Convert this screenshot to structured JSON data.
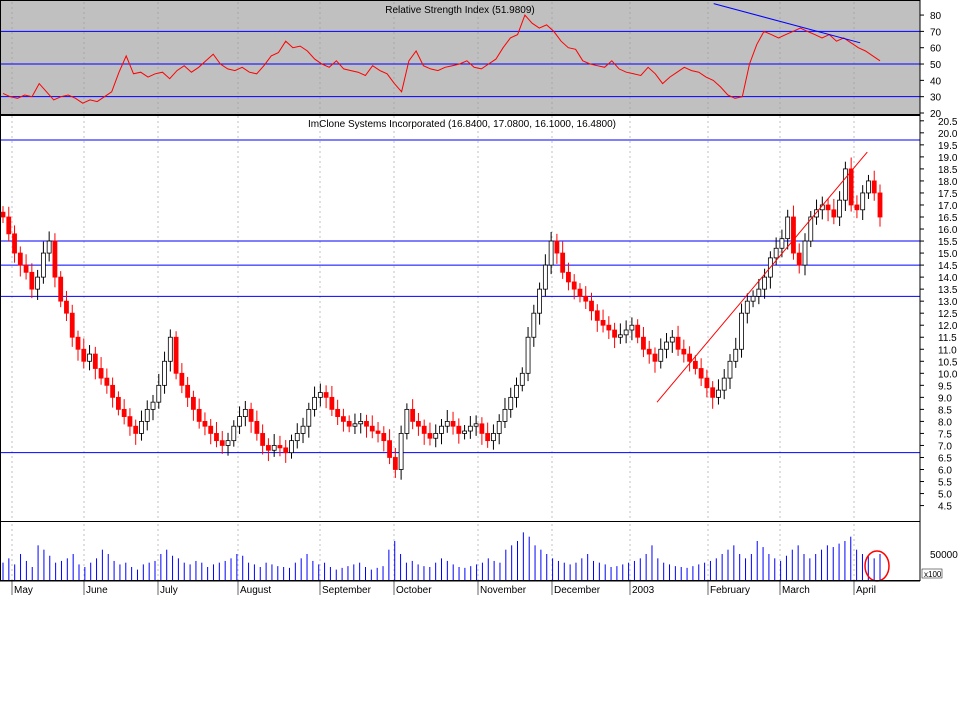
{
  "chart_data": [
    {
      "type": "line",
      "title": "Relative Strength Index (51.9809)",
      "ylim": [
        20,
        88
      ],
      "yticks": [
        20,
        30,
        40,
        50,
        60,
        70,
        80
      ],
      "reference_lines": [
        30,
        50,
        70
      ],
      "trendline": {
        "from": {
          "x": "2003-02-22",
          "y": 87
        },
        "to": {
          "x": "2003-04-25",
          "y": 63
        }
      },
      "background": "#c0c0c0",
      "series": [
        {
          "color": "#ff0000",
          "values": [
            32,
            30,
            29,
            31,
            30,
            38,
            33,
            28,
            30,
            31,
            29,
            26,
            28,
            27,
            30,
            33,
            45,
            55,
            44,
            45,
            42,
            44,
            45,
            41,
            46,
            49,
            45,
            48,
            52,
            56,
            50,
            47,
            46,
            48,
            45,
            44,
            49,
            55,
            57,
            64,
            60,
            61,
            58,
            53,
            50,
            48,
            52,
            47,
            46,
            45,
            43,
            49,
            46,
            44,
            38,
            33,
            52,
            58,
            49,
            47,
            46,
            48,
            49,
            50,
            52,
            48,
            47,
            50,
            53,
            60,
            66,
            68,
            80,
            75,
            72,
            74,
            70,
            64,
            60,
            59,
            52,
            50,
            49,
            48,
            52,
            47,
            45,
            44,
            43,
            48,
            44,
            38,
            42,
            45,
            48,
            46,
            45,
            42,
            40,
            36,
            31,
            29,
            30,
            50,
            62,
            70,
            68,
            66,
            68,
            70,
            72,
            70,
            68,
            66,
            68,
            64,
            66,
            63,
            60,
            58,
            55,
            52
          ]
        }
      ]
    },
    {
      "type": "candlestick",
      "title": "ImClone Systems Incorporated (16.8400, 17.0800, 16.1000, 16.4800)",
      "ylim": [
        3.9,
        20.7
      ],
      "yticks": [
        "4.5",
        "5.0",
        "5.5",
        "6.0",
        "6.5",
        "7.0",
        "7.5",
        "8.0",
        "8.5",
        "9.0",
        "9.5",
        "10.0",
        "10.5",
        "11.0",
        "11.5",
        "12.0",
        "12.5",
        "13.0",
        "13.5",
        "14.0",
        "14.5",
        "15.0",
        "15.5",
        "16.0",
        "16.5",
        "17.0",
        "17.5",
        "18.0",
        "18.5",
        "19.0",
        "19.5",
        "20.0",
        "20.5"
      ],
      "horizontal_lines": [
        6.7,
        13.2,
        14.5,
        15.5,
        19.7
      ],
      "trendline": {
        "from": {
          "x": "2003-01-29",
          "y": 8.8
        },
        "to": {
          "x": "2003-04-28",
          "y": 19.2
        }
      },
      "colors": {
        "down": "#ff0000",
        "up": "#000000",
        "hline": "#0000ff",
        "trend": "#ff0000"
      },
      "close": [
        16.5,
        15.8,
        15.0,
        14.5,
        14.2,
        13.5,
        14.0,
        15.0,
        15.5,
        14.0,
        13.0,
        12.5,
        11.5,
        11.0,
        10.5,
        10.8,
        10.2,
        9.8,
        9.5,
        9.0,
        8.5,
        8.2,
        7.8,
        7.5,
        8.0,
        8.5,
        8.8,
        9.5,
        10.5,
        11.5,
        10.0,
        9.5,
        9.0,
        8.5,
        8.0,
        7.8,
        7.5,
        7.2,
        7.0,
        7.2,
        7.8,
        8.2,
        8.5,
        8.0,
        7.5,
        7.0,
        6.8,
        7.0,
        6.9,
        6.7,
        7.2,
        7.5,
        7.8,
        8.5,
        9.0,
        9.2,
        9.0,
        8.5,
        8.2,
        8.0,
        7.8,
        7.9,
        8.0,
        7.8,
        7.6,
        7.5,
        7.2,
        6.5,
        6.0,
        7.5,
        8.5,
        8.0,
        7.8,
        7.5,
        7.3,
        7.5,
        7.8,
        8.0,
        7.8,
        7.5,
        7.6,
        7.8,
        7.9,
        7.5,
        7.2,
        7.5,
        8.0,
        8.5,
        9.0,
        9.5,
        10.0,
        11.5,
        12.5,
        13.5,
        14.5,
        15.5,
        15.0,
        14.2,
        13.8,
        13.5,
        13.2,
        13.0,
        12.6,
        12.2,
        12.0,
        11.8,
        11.5,
        11.6,
        11.8,
        12.0,
        11.5,
        11.0,
        10.8,
        10.5,
        11.0,
        11.3,
        11.5,
        11.0,
        10.8,
        10.5,
        10.2,
        9.8,
        9.4,
        9.0,
        9.3,
        9.8,
        10.5,
        11.0,
        12.5,
        13.0,
        13.2,
        13.5,
        14.0,
        14.8,
        15.2,
        15.6,
        16.5,
        15.0,
        14.5,
        15.5,
        16.5,
        16.8,
        17.0,
        16.8,
        16.5,
        17.2,
        18.5,
        17.0,
        16.8,
        17.5,
        18.0,
        17.5,
        16.5
      ]
    },
    {
      "type": "bar",
      "title": "",
      "ylabel_tick": "50000",
      "scale_label": "x100",
      "bar_color": "#0000ff",
      "values": [
        20,
        25,
        18,
        30,
        22,
        15,
        40,
        35,
        28,
        20,
        22,
        25,
        30,
        18,
        15,
        20,
        25,
        35,
        30,
        22,
        18,
        20,
        15,
        12,
        18,
        20,
        22,
        30,
        35,
        28,
        25,
        20,
        18,
        22,
        20,
        15,
        18,
        20,
        22,
        25,
        30,
        28,
        20,
        18,
        15,
        20,
        18,
        16,
        15,
        14,
        20,
        25,
        30,
        22,
        18,
        20,
        15,
        12,
        14,
        16,
        18,
        20,
        15,
        12,
        14,
        16,
        35,
        45,
        30,
        20,
        22,
        18,
        16,
        15,
        20,
        25,
        22,
        18,
        15,
        14,
        16,
        18,
        20,
        25,
        22,
        20,
        35,
        40,
        45,
        55,
        50,
        40,
        35,
        30,
        25,
        22,
        20,
        18,
        20,
        25,
        30,
        22,
        20,
        18,
        15,
        16,
        18,
        20,
        22,
        25,
        30,
        40,
        25,
        20,
        18,
        16,
        15,
        14,
        16,
        18,
        20,
        22,
        25,
        30,
        35,
        40,
        30,
        25,
        30,
        45,
        38,
        30,
        25,
        22,
        28,
        35,
        40,
        30,
        25,
        30,
        35,
        40,
        38,
        42,
        45,
        50,
        35,
        30,
        28,
        25,
        30
      ]
    },
    {
      "type": "axis",
      "months": [
        {
          "label": "May"
        },
        {
          "label": "June"
        },
        {
          "label": "July"
        },
        {
          "label": "August"
        },
        {
          "label": "September"
        },
        {
          "label": "October"
        },
        {
          "label": "November"
        },
        {
          "label": "December"
        },
        {
          "label": "2003"
        },
        {
          "label": "February"
        },
        {
          "label": "March"
        },
        {
          "label": "April"
        }
      ]
    }
  ]
}
